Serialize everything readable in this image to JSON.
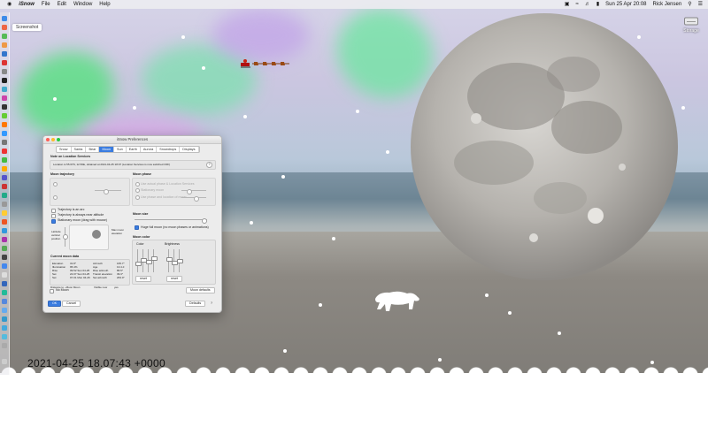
{
  "menubar": {
    "apple": "",
    "app": "iSnow",
    "items": [
      "File",
      "Edit",
      "Window",
      "Help"
    ],
    "clock": "Sun 25 Apr  20:08",
    "user": "Rick Jensen"
  },
  "desktop": {
    "screenshot_label": "Screenshot",
    "drive_label": "Storage",
    "timestamp": "2021-04-25 18.07:43 +0000"
  },
  "prefs": {
    "title": "iSnow Preferences",
    "tabs": [
      "Snow",
      "Santa",
      "Bear",
      "Moon",
      "Sun",
      "Earth",
      "Aurora",
      "Snowdrops",
      "Displays"
    ],
    "active_tab": "Moon",
    "location_header": "Note on Location Services",
    "location_text": "Location is 55.67N, 12.56E, obtained at 2021-04-25 18:07 (Location Services is now switched OFF)",
    "trajectory_header": "Moon trajectory",
    "trajectory_opt1": "Trajectory is an arc",
    "trajectory_opt2": "Trajectory is always near altitude",
    "trajectory_opt3": "Stationary moon (drag with mouse)",
    "latitude_label": "Latitude vertical position",
    "max_label": "Max moon elevation",
    "current_header": "Current moon data",
    "current_rows": [
      [
        "Elevation",
        "31.8°",
        "Azimuth",
        "165.7°"
      ],
      [
        "Illumination",
        "95.4%",
        "Age",
        "13.4 d"
      ],
      [
        "Rise",
        "09.52 Sun 04-25",
        "Rise azimuth",
        "86.5°"
      ],
      [
        "Set",
        "22.07 Sun 04-25",
        "Transit elevation",
        "39.3°"
      ],
      [
        "Set",
        "07.01 Mon 04-26",
        "Set azimuth",
        "263.0°"
      ]
    ],
    "distance_label": "Distance to ~Moon Moon",
    "visible_label": "Visible now",
    "visible_value": "yes",
    "phase_header": "Moon phase",
    "phase_opt1": "Use actual phase & Location Services",
    "phase_opt2": "Stationary moon",
    "phase_opt3": "Use phase and location of moon",
    "moon_size_header": "Moon size",
    "huge_full": "Huge full moon (no moon phases or animations)",
    "moon_color_header": "Moon color",
    "color_label": "Color",
    "brightness_label": "Brightness",
    "reset_label": "reset",
    "no_moon": "No Moon",
    "moon_defaults": "Moon defaults",
    "ok": "OK",
    "cancel": "Cancel",
    "defaults": "Defaults",
    "help": "?"
  }
}
